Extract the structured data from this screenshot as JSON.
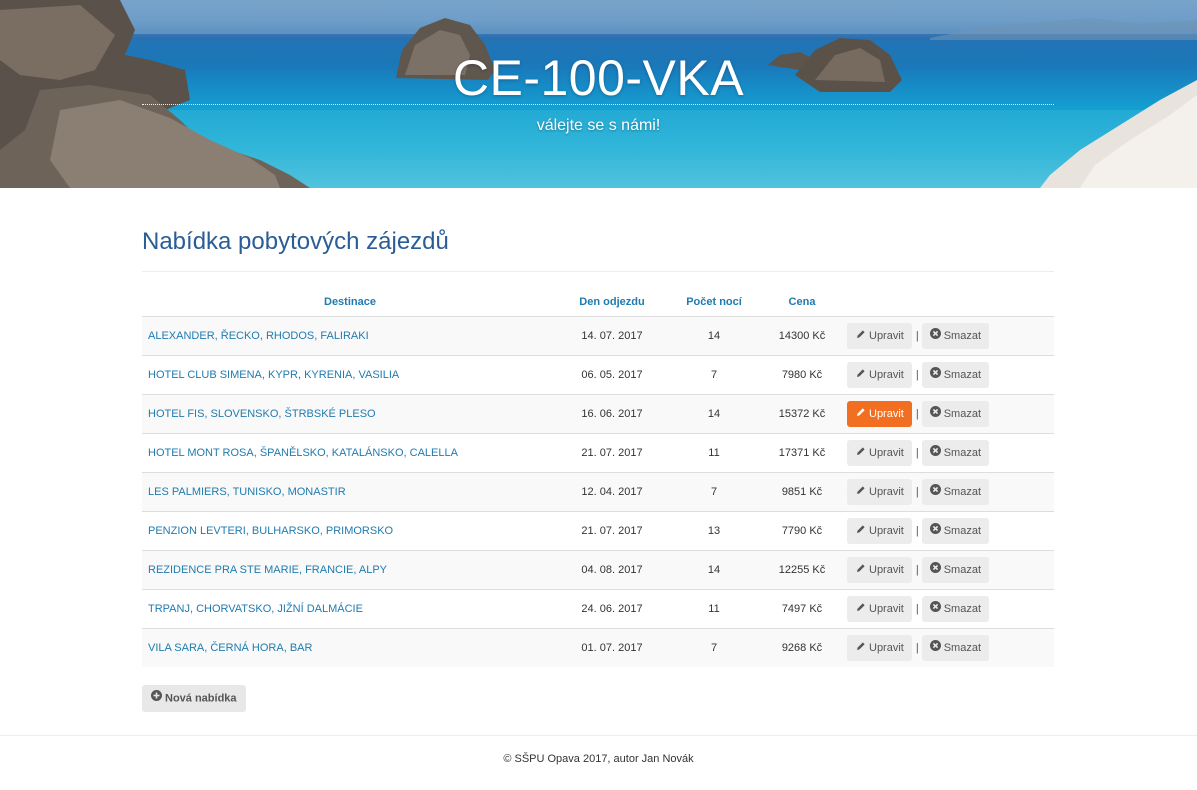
{
  "header": {
    "title": "CE-100-VKA",
    "subtitle": "válejte se s námi!"
  },
  "main": {
    "heading": "Nabídka pobytových zájezdů",
    "table": {
      "headers": [
        "Destinace",
        "Den odjezdu",
        "Počet nocí",
        "Cena"
      ],
      "rows": [
        {
          "destination": "ALEXANDER, ŘECKO, RHODOS, FALIRAKI",
          "date": "14. 07. 2017",
          "nights": "14",
          "price": "14300 Kč"
        },
        {
          "destination": "HOTEL CLUB SIMENA, KYPR, KYRENIA, VASILIA",
          "date": "06. 05. 2017",
          "nights": "7",
          "price": "7980 Kč"
        },
        {
          "destination": "HOTEL FIS, SLOVENSKO, ŠTRBSKÉ PLESO",
          "date": "16. 06. 2017",
          "nights": "14",
          "price": "15372 Kč"
        },
        {
          "destination": "HOTEL MONT ROSA, ŠPANĚLSKO, KATALÁNSKO, CALELLA",
          "date": "21. 07. 2017",
          "nights": "11",
          "price": "17371 Kč"
        },
        {
          "destination": "LES PALMIERS, TUNISKO, MONASTIR",
          "date": "12. 04. 2017",
          "nights": "7",
          "price": "9851 Kč"
        },
        {
          "destination": "PENZION LEVTERI, BULHARSKO, PRIMORSKO",
          "date": "21. 07. 2017",
          "nights": "13",
          "price": "7790 Kč"
        },
        {
          "destination": "REZIDENCE PRA STE MARIE, FRANCIE, ALPY",
          "date": "04. 08. 2017",
          "nights": "14",
          "price": "12255 Kč"
        },
        {
          "destination": "TRPANJ, CHORVATSKO, JIŽNÍ DALMÁCIE",
          "date": "24. 06. 2017",
          "nights": "11",
          "price": "7497 Kč"
        },
        {
          "destination": "VILA SARA, ČERNÁ HORA, BAR",
          "date": "01. 07. 2017",
          "nights": "7",
          "price": "9268 Kč"
        }
      ],
      "edit_label": "Upravit",
      "delete_label": "Smazat",
      "separator": "|",
      "highlighted_row": 2
    },
    "add_label": "Nová nabídka"
  },
  "footer": {
    "text": "© SŠPU Opava 2017, autor Jan Novák"
  },
  "colors": {
    "link": "#1f7bb0",
    "heading": "#2a5d95",
    "accent_button": "#f26f21"
  },
  "icons": {
    "edit": "pencil-icon",
    "delete": "remove-circle-icon",
    "add": "plus-circle-icon"
  }
}
